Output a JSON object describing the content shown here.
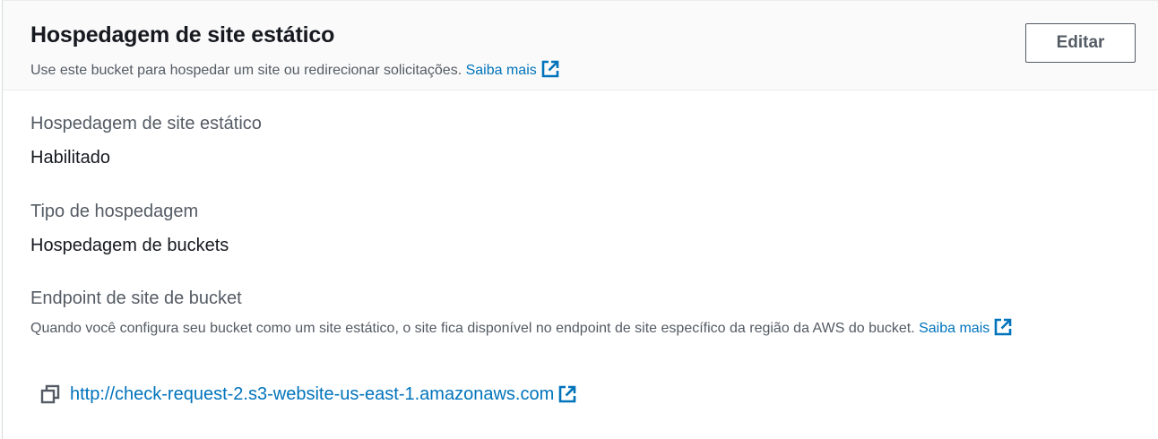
{
  "header": {
    "title": "Hospedagem de site estático",
    "description": "Use este bucket para hospedar um site ou redirecionar solicitações.",
    "learn_more": "Saiba mais",
    "edit_label": "Editar"
  },
  "fields": {
    "hosting": {
      "label": "Hospedagem de site estático",
      "value": "Habilitado"
    },
    "hosting_type": {
      "label": "Tipo de hospedagem",
      "value": "Hospedagem de buckets"
    },
    "endpoint": {
      "label": "Endpoint de site de bucket",
      "help": "Quando você configura seu bucket como um site estático, o site fica disponível no endpoint de site específico da região da AWS do bucket.",
      "learn_more": "Saiba mais",
      "url": "http://check-request-2.s3-website-us-east-1.amazonaws.com"
    }
  },
  "icons": {
    "external": "external-link-icon",
    "copy": "copy-icon"
  },
  "colors": {
    "link": "#0073bb",
    "text": "#16191f",
    "secondary_text": "#545b64",
    "header_bg": "#fafafa"
  }
}
